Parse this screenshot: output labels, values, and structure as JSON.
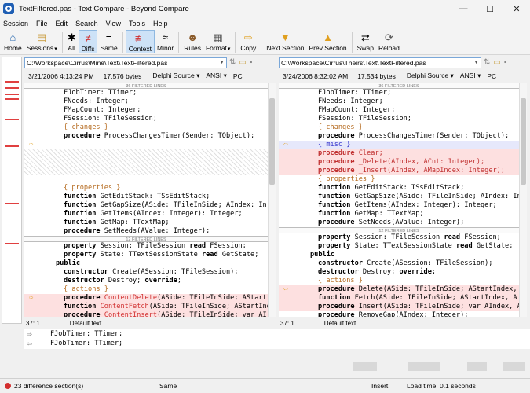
{
  "window": {
    "title": "TextFiltered.pas - Text Compare - Beyond Compare",
    "controls": [
      "—",
      "☐",
      "✕"
    ]
  },
  "menu": [
    "Session",
    "File",
    "Edit",
    "Search",
    "View",
    "Tools",
    "Help"
  ],
  "toolbar": {
    "buttons": [
      {
        "label": "Home",
        "icon": "home-icon"
      },
      {
        "label": "Sessions",
        "icon": "sessions-icon"
      },
      {
        "label": "All",
        "icon": "all-icon"
      },
      {
        "label": "Diffs",
        "icon": "diffs-icon"
      },
      {
        "label": "Same",
        "icon": "same-icon"
      },
      {
        "label": "Context",
        "icon": "context-icon"
      },
      {
        "label": "Minor",
        "icon": "minor-icon"
      },
      {
        "label": "Rules",
        "icon": "rules-icon"
      },
      {
        "label": "Format",
        "icon": "format-icon"
      },
      {
        "label": "Copy",
        "icon": "copy-icon"
      },
      {
        "label": "Next Section",
        "icon": "next-section-icon"
      },
      {
        "label": "Prev Section",
        "icon": "prev-section-icon"
      },
      {
        "label": "Swap",
        "icon": "swap-icon"
      },
      {
        "label": "Reload",
        "icon": "reload-icon"
      }
    ]
  },
  "left": {
    "path": "C:\\Workspace\\Cirrus\\Mine\\Text\\TextFiltered.pas",
    "date": "3/21/2006 4:13:24 PM",
    "size": "17,576 bytes",
    "format": "Delphi Source",
    "encoding": "ANSI",
    "lineend": "PC",
    "position": "37: 1",
    "textkind": "Default text"
  },
  "right": {
    "path": "C:\\Workspace\\Cirrus\\Theirs\\Text\\TextFiltered.pas",
    "date": "3/24/2006 8:32:02 AM",
    "size": "17,534 bytes",
    "format": "Delphi Source",
    "encoding": "ANSI",
    "lineend": "PC",
    "position": "37: 1",
    "textkind": "Default text"
  },
  "filtered": {
    "first": "36 FILTERED LINES",
    "second": "12 FILTERED LINES"
  },
  "detail": {
    "line1": "FJobTimer: TTimer;",
    "line2": "FJobTimer: TTimer;"
  },
  "status": {
    "differences": "23 difference section(s)",
    "same": "Same",
    "mode": "Insert",
    "loadtime": "Load time: 0.1 seconds"
  }
}
